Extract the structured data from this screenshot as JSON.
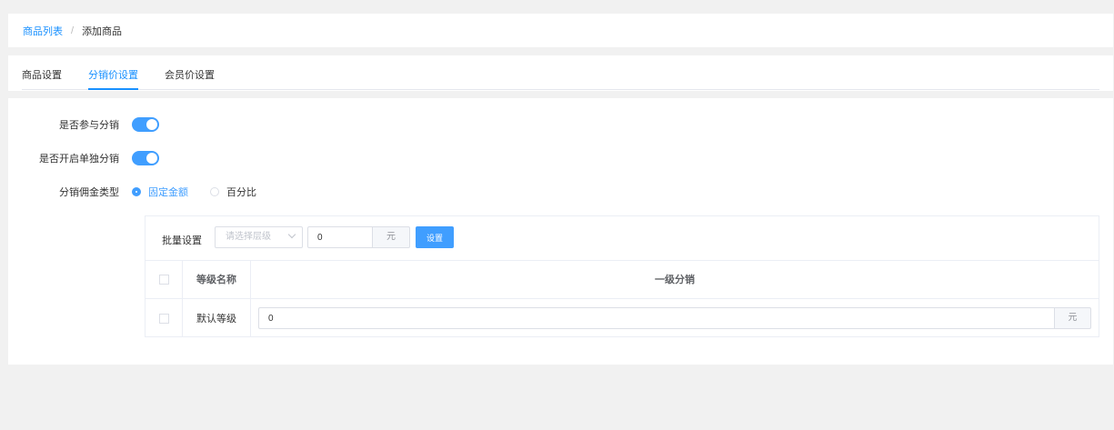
{
  "breadcrumb": {
    "link": "商品列表",
    "separator": "/",
    "current": "添加商品"
  },
  "tabs": [
    {
      "label": "商品设置",
      "active": false
    },
    {
      "label": "分销价设置",
      "active": true
    },
    {
      "label": "会员价设置",
      "active": false
    }
  ],
  "form": {
    "participate_label": "是否参与分销",
    "independent_label": "是否开启单独分销",
    "commission_type_label": "分销佣金类型",
    "commission_options": [
      "固定金额",
      "百分比"
    ],
    "commission_selected": "固定金额"
  },
  "batch": {
    "label": "批量设置",
    "select_placeholder": "请选择层级",
    "value": "0",
    "unit": "元",
    "button_label": "设置"
  },
  "table": {
    "headers": [
      "等级名称",
      "一级分销"
    ],
    "rows": [
      {
        "name": "默认等级",
        "value": "0",
        "unit": "元"
      }
    ]
  },
  "colors": {
    "accent": "#409eff",
    "link": "#1890ff"
  }
}
